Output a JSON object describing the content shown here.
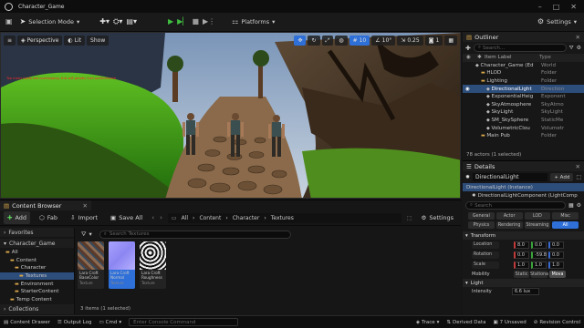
{
  "titlebar": {
    "project": "Character_Game"
  },
  "toolbar": {
    "selection_mode": "Selection Mode",
    "platforms": "Platforms",
    "settings": "Settings"
  },
  "viewport": {
    "perspective": "Perspective",
    "lit": "Lit",
    "show": "Show",
    "grid_snap": "10",
    "rot_snap": "10°",
    "scale_snap": "0.25",
    "cam_speed": "1",
    "warning_text": "Too many lights are overlapping, this will greatly hurt performance"
  },
  "outliner": {
    "title": "Outliner",
    "search_placeholder": "Search...",
    "col_label": "Item Label",
    "col_type": "Type",
    "rows": [
      {
        "name": "Character_Game (Ed",
        "type": "World",
        "indent": 0,
        "icon": "world-icon"
      },
      {
        "name": "HLOD",
        "type": "Folder",
        "indent": 1,
        "icon": "folder-icon"
      },
      {
        "name": "Lighting",
        "type": "Folder",
        "indent": 1,
        "icon": "folder-icon"
      },
      {
        "name": "DirectionalLight",
        "type": "Direction",
        "indent": 2,
        "icon": "light-icon",
        "selected": true
      },
      {
        "name": "ExponentialHeig",
        "type": "Exponent",
        "indent": 2,
        "icon": "fog-icon"
      },
      {
        "name": "SkyAtmosphere",
        "type": "SkyAtmo",
        "indent": 2,
        "icon": "sky-icon"
      },
      {
        "name": "SkyLight",
        "type": "SkyLight",
        "indent": 2,
        "icon": "skylight-icon"
      },
      {
        "name": "SM_SkySphere",
        "type": "StaticMe",
        "indent": 2,
        "icon": "mesh-icon"
      },
      {
        "name": "VolumetricClou",
        "type": "Volumetr",
        "indent": 2,
        "icon": "cloud-icon"
      },
      {
        "name": "Main Pub",
        "type": "Folder",
        "indent": 1,
        "icon": "folder-icon"
      }
    ],
    "footer": "78 actors (1 selected)"
  },
  "details": {
    "tab": "Details",
    "actor": "DirectionalLight",
    "add": "+ Add",
    "component_root": "DirectionalLight (Instance)",
    "component_child": "DirectionalLightComponent (LightComp",
    "search_placeholder": "Search",
    "filters_row1": [
      "General",
      "Actor",
      "LOD",
      "Misc"
    ],
    "filters_row2": [
      "Physics",
      "Rendering",
      "Streaming",
      "All"
    ],
    "section_transform": "Transform",
    "location": {
      "label": "Location",
      "x": "8.0",
      "y": "0.0",
      "z": "0.0"
    },
    "rotation": {
      "label": "Rotation",
      "x": "0.0",
      "y": "-59.8",
      "z": "0.0"
    },
    "scale": {
      "label": "Scale",
      "x": "1.0",
      "y": "1.0",
      "z": "1.0"
    },
    "mobility": {
      "label": "Mobility",
      "options": [
        "Static",
        "Stationa",
        "Mova"
      ]
    },
    "section_light": "Light",
    "intensity": {
      "label": "Intensity",
      "value": "6.6 lux"
    }
  },
  "content_browser": {
    "tab": "Content Browser",
    "add": "Add",
    "fab": "Fab",
    "import": "Import",
    "save_all": "Save All",
    "path": [
      "All",
      "Content",
      "Character",
      "Textures"
    ],
    "settings": "Settings",
    "favorites": "Favorites",
    "root": "Character_Game",
    "search_placeholder": "Search Textures",
    "collections": "Collections",
    "tree": [
      {
        "label": "All",
        "indent": 0
      },
      {
        "label": "Content",
        "indent": 1
      },
      {
        "label": "Character",
        "indent": 2
      },
      {
        "label": "Textures",
        "indent": 3,
        "selected": true
      },
      {
        "label": "Environment",
        "indent": 2
      },
      {
        "label": "StarterContent",
        "indent": 2
      },
      {
        "label": "Temp Content",
        "indent": 1
      }
    ],
    "assets": [
      {
        "name": "Lara Croft BaseColor",
        "type": "Texture"
      },
      {
        "name": "Lara Croft Normal",
        "type": "Texture"
      },
      {
        "name": "Lara Croft Roughness",
        "type": "Texture"
      }
    ],
    "footer": "3 items (1 selected)"
  },
  "statusbar": {
    "content_drawer": "Content Drawer",
    "output_log": "Output Log",
    "cmd": "Cmd",
    "console_placeholder": "Enter Console Command",
    "trace": "Trace",
    "derived_data": "Derived Data",
    "unsaved": "7 Unsaved",
    "revision": "Revision Control"
  }
}
